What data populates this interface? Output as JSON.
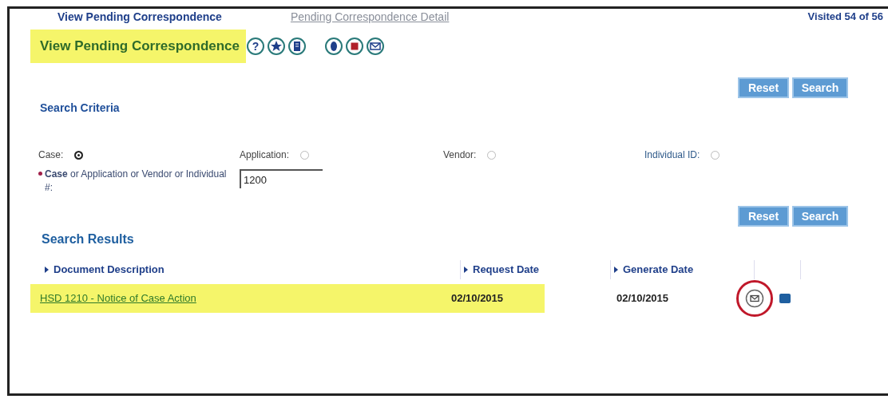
{
  "header_tabs": [
    {
      "label": "View Pending Correspondence",
      "selected": true
    },
    {
      "label": "Pending Correspondence Detail",
      "selected": false
    }
  ],
  "visited": "Visited 54 of 56",
  "page_title": {
    "text": "View Pending Correspondence",
    "highlighted": true,
    "help_glyph": "?"
  },
  "top_buttons": [
    "Reset",
    "Search"
  ],
  "search_criteria": {
    "title": "Search Criteria",
    "options": [
      {
        "label": "Case:",
        "selected": true
      },
      {
        "label": "Application:",
        "selected": false
      },
      {
        "label": "Vendor:",
        "selected": false
      },
      {
        "label": "Individual ID:",
        "selected": false
      }
    ],
    "field": {
      "label": "**Case** or Application or Vendor or Individual #:",
      "required": true,
      "value": "1200"
    }
  },
  "bottom_buttons": [
    "Reset",
    "Search"
  ],
  "results": {
    "title": "Search Results",
    "columns": [
      "Document Description",
      "Request Date",
      "Generate Date"
    ],
    "rows": [
      {
        "document": "HSD 1210 - Notice of Case Action",
        "request_date": "02/10/2015",
        "generate_date": "02/10/2015",
        "highlighted": true,
        "circled": true
      }
    ]
  }
}
